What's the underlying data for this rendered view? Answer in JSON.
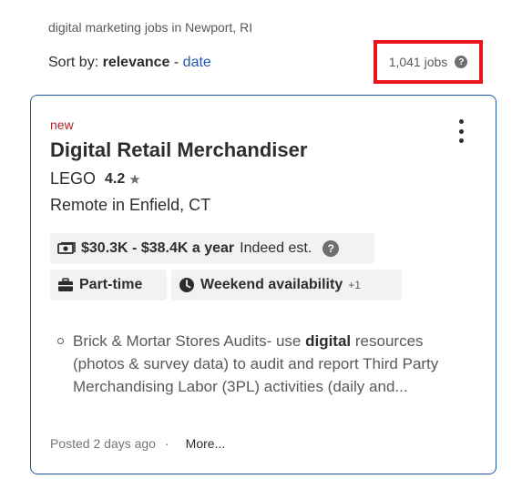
{
  "header": {
    "search_caption": "digital marketing jobs in Newport, RI",
    "sort_label": "Sort by:",
    "sort_active": "relevance",
    "sort_separator": "-",
    "sort_alt": "date",
    "job_count": "1,041 jobs",
    "job_count_help_icon": "question-circle-icon",
    "highlight_color": "#e8141b"
  },
  "job": {
    "badge": "new",
    "title": "Digital Retail Merchandiser",
    "company": "LEGO",
    "rating": "4.2",
    "rating_icon": "star-icon",
    "location": "Remote in Enfield, CT",
    "salary": "$30.3K - $38.4K a year",
    "salary_note": "Indeed est.",
    "salary_icon": "money-icon",
    "job_type": "Part-time",
    "job_type_icon": "briefcase-icon",
    "schedule": "Weekend availability",
    "schedule_extra": "+1",
    "schedule_icon": "clock-icon",
    "snippet_before": "Brick & Mortar Stores Audits- use ",
    "snippet_bold": "digital",
    "snippet_after": " resources (photos & survey data) to audit and report Third Party Merchandising Labor (3PL) activities (daily and...",
    "posted": "Posted 2 days ago",
    "dot": "·",
    "more": "More...",
    "more_menu_icon": "vertical-ellipsis-icon"
  },
  "colors": {
    "link": "#2557a7",
    "new_badge": "#a9252b",
    "chip_bg": "#f3f2f1"
  }
}
